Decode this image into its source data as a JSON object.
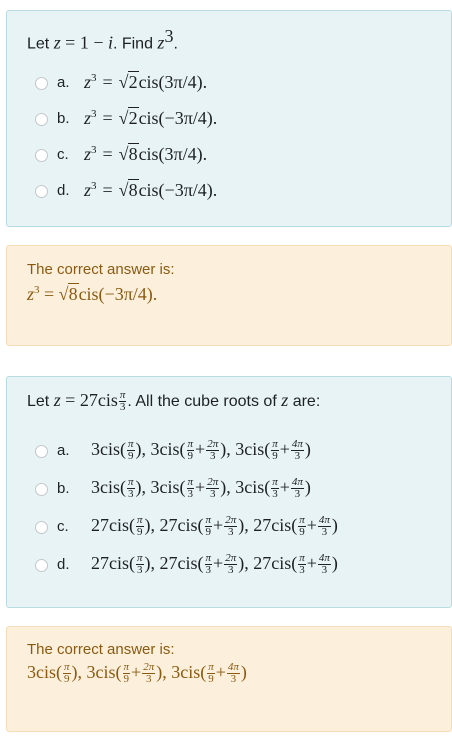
{
  "q1": {
    "stem_prefix": "Let",
    "stem_z": "z",
    "stem_eq": "= 1 −",
    "stem_i": "i",
    "stem_find": ". Find",
    "stem_target": "z",
    "stem_pow": "3",
    "stem_end": ".",
    "options": [
      {
        "letter": "a.",
        "root": "2",
        "arg": "cis(3π/4)."
      },
      {
        "letter": "b.",
        "root": "2",
        "arg": "cis(−3π/4)."
      },
      {
        "letter": "c.",
        "root": "8",
        "arg": "cis(3π/4)."
      },
      {
        "letter": "d.",
        "root": "8",
        "arg": "cis(−3π/4)."
      }
    ],
    "lhs_z": "z",
    "lhs_pow": "3",
    "eq": "=",
    "sqrt_sign": "√",
    "feedback_label": "The correct answer is:",
    "feedback_root": "8",
    "feedback_arg": "cis(−3π/4)."
  },
  "q2": {
    "stem_prefix": "Let",
    "stem_z": "z",
    "stem_eq": "= 27cis",
    "stem_frac_num": "π",
    "stem_frac_den": "3",
    "stem_rest": ". All the cube roots of",
    "stem_z2": "z",
    "stem_end": "are:",
    "options": [
      {
        "letter": "a.",
        "coef": "3cis(",
        "d": [
          "9",
          "9",
          "3",
          "9",
          "3"
        ]
      },
      {
        "letter": "b.",
        "coef": "3cis(",
        "d": [
          "3",
          "3",
          "3",
          "3",
          "3"
        ]
      },
      {
        "letter": "c.",
        "coef": "27cis(",
        "d": [
          "9",
          "9",
          "3",
          "9",
          "3"
        ]
      },
      {
        "letter": "d.",
        "coef": "27cis(",
        "d": [
          "3",
          "3",
          "3",
          "3",
          "3"
        ]
      }
    ],
    "pi": "π",
    "two_pi": "2π",
    "four_pi": "4π",
    "plus": "+",
    "close_comma": "), ",
    "close": ")",
    "feedback_label": "The correct answer is:",
    "feedback": {
      "coef": "3cis(",
      "d": [
        "9",
        "9",
        "3",
        "9",
        "3"
      ]
    }
  }
}
